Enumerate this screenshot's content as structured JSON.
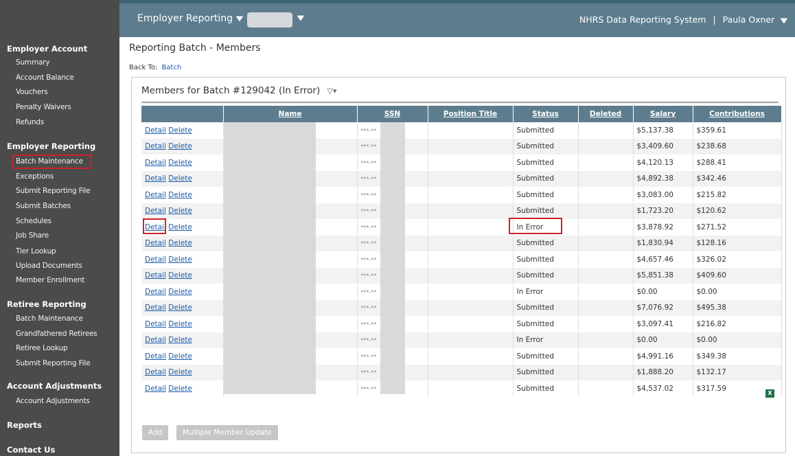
{
  "topbar": {
    "menu_label": "Employer Reporting",
    "system_name": "NHRS Data Reporting System",
    "separator": "|",
    "user_name": "Paula Oxner"
  },
  "sidebar": {
    "sections": [
      {
        "label": "Employer Account",
        "items": [
          "Summary",
          "Account Balance",
          "Vouchers",
          "Penalty Waivers",
          "Refunds"
        ]
      },
      {
        "label": "Employer Reporting",
        "items": [
          "Batch Maintenance",
          "Exceptions",
          "Submit Reporting File",
          "Submit Batches",
          "Schedules",
          "Job Share",
          "Tier Lookup",
          "Upload Documents",
          "Member Enrollment"
        ]
      },
      {
        "label": "Retiree Reporting",
        "items": [
          "Batch Maintenance",
          "Grandfathered Retirees",
          "Retiree Lookup",
          "Submit Reporting File"
        ]
      },
      {
        "label": "Account Adjustments",
        "items": [
          "Account Adjustments"
        ]
      },
      {
        "label": "Reports",
        "items": []
      },
      {
        "label": "Contact Us",
        "items": []
      }
    ]
  },
  "page": {
    "title": "Reporting Batch - Members",
    "back_to_label": "Back To:",
    "back_to_link": "Batch",
    "panel_title": "Members for Batch #129042 (In Error)"
  },
  "table": {
    "columns": [
      "",
      "Name",
      "SSN",
      "Position Title",
      "Status",
      "Deleted",
      "Salary",
      "Contributions"
    ],
    "detail_label": "Detail",
    "delete_label": "Delete",
    "ssn_mask": "***-**",
    "rows": [
      {
        "status": "Submitted",
        "salary": "$5,137.38",
        "contributions": "$359.61"
      },
      {
        "status": "Submitted",
        "salary": "$3,409.60",
        "contributions": "$238.68"
      },
      {
        "status": "Submitted",
        "salary": "$4,120.13",
        "contributions": "$288.41"
      },
      {
        "status": "Submitted",
        "salary": "$4,892.38",
        "contributions": "$342.46"
      },
      {
        "status": "Submitted",
        "salary": "$3,083.00",
        "contributions": "$215.82"
      },
      {
        "status": "Submitted",
        "salary": "$1,723.20",
        "contributions": "$120.62"
      },
      {
        "status": "In Error",
        "salary": "$3,878.92",
        "contributions": "$271.52"
      },
      {
        "status": "Submitted",
        "salary": "$1,830.94",
        "contributions": "$128.16"
      },
      {
        "status": "Submitted",
        "salary": "$4,657.46",
        "contributions": "$326.02"
      },
      {
        "status": "Submitted",
        "salary": "$5,851.38",
        "contributions": "$409.60"
      },
      {
        "status": "In Error",
        "salary": "$0.00",
        "contributions": "$0.00"
      },
      {
        "status": "Submitted",
        "salary": "$7,076.92",
        "contributions": "$495.38"
      },
      {
        "status": "Submitted",
        "salary": "$3,097.41",
        "contributions": "$216.82"
      },
      {
        "status": "In Error",
        "salary": "$0.00",
        "contributions": "$0.00"
      },
      {
        "status": "Submitted",
        "salary": "$4,991.16",
        "contributions": "$349.38"
      },
      {
        "status": "Submitted",
        "salary": "$1,888.20",
        "contributions": "$132.17"
      },
      {
        "status": "Submitted",
        "salary": "$4,537.02",
        "contributions": "$317.59"
      }
    ]
  },
  "buttons": {
    "add": "Add",
    "multiple_update": "Multiple Member Update"
  },
  "icons": {
    "menu_chevron": "chevron-down-icon",
    "filter": "filter-icon",
    "export": "excel-icon"
  },
  "colors": {
    "sidebar_bg": "#4b4b4b",
    "topbar_bg": "#5d7d8e",
    "header_bg": "#5d7d8e",
    "link": "#1a5aa8",
    "highlight": "#d0202a"
  }
}
